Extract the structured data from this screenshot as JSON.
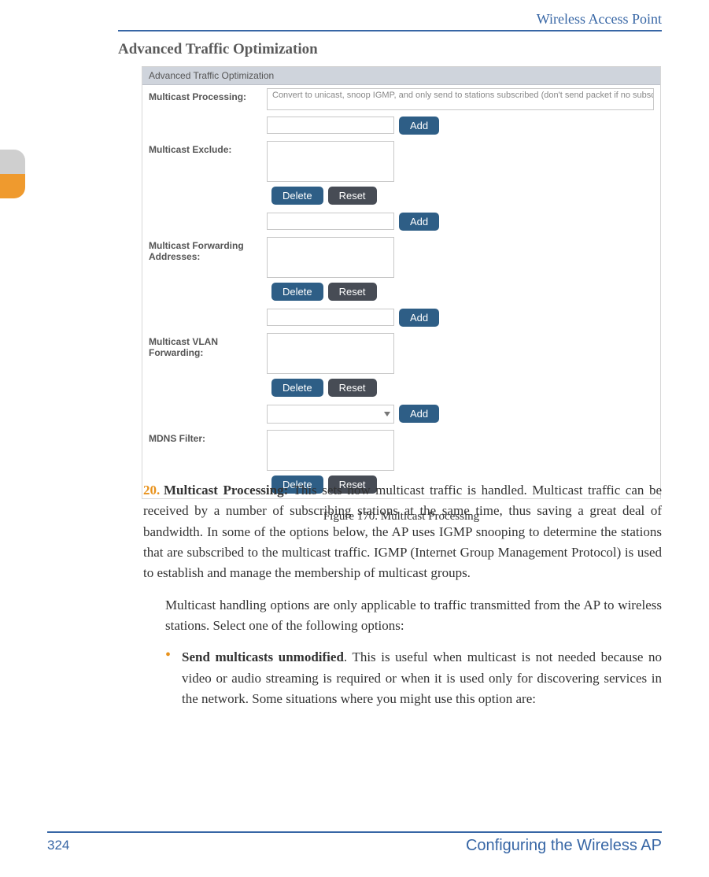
{
  "header": {
    "title": "Wireless Access Point"
  },
  "section": {
    "title": "Advanced Traffic Optimization"
  },
  "figure": {
    "panel_title": "Advanced Traffic Optimization",
    "rows": {
      "processing_label": "Multicast Processing:",
      "processing_value": "Convert to unicast, snoop IGMP, and only send to stations subscribed (don't send packet if no subscription)",
      "exclude_label": "Multicast Exclude:",
      "forwarding_label": "Multicast Forwarding Addresses:",
      "vlan_label": "Multicast VLAN Forwarding:",
      "mdns_label": "MDNS Filter:"
    },
    "buttons": {
      "add": "Add",
      "delete": "Delete",
      "reset": "Reset"
    },
    "caption": "Figure 170. Multicast Processing"
  },
  "body": {
    "item_number": "20.",
    "lead_bold": "Multicast Processing:",
    "lead_rest": " This sets how multicast traffic is handled. Multicast traffic can be received by a number of subscribing stations at the same time, thus saving a great deal of bandwidth. In some of the options below, the AP uses IGMP snooping to determine the stations that are subscribed to the multicast traffic. IGMP (Internet Group Management Protocol) is used to establish and manage the membership of multicast groups.",
    "para2": "Multicast handling options are only applicable to traffic transmitted from the AP to wireless stations. Select one of the following options:",
    "bullet_bold": "Send multicasts unmodified",
    "bullet_rest": ". This is useful when multicast is not needed because no video or audio streaming is required or when it is used only for discovering services in the network. Some situations where you might use this option are:"
  },
  "footer": {
    "page": "324",
    "title": "Configuring the Wireless AP"
  }
}
